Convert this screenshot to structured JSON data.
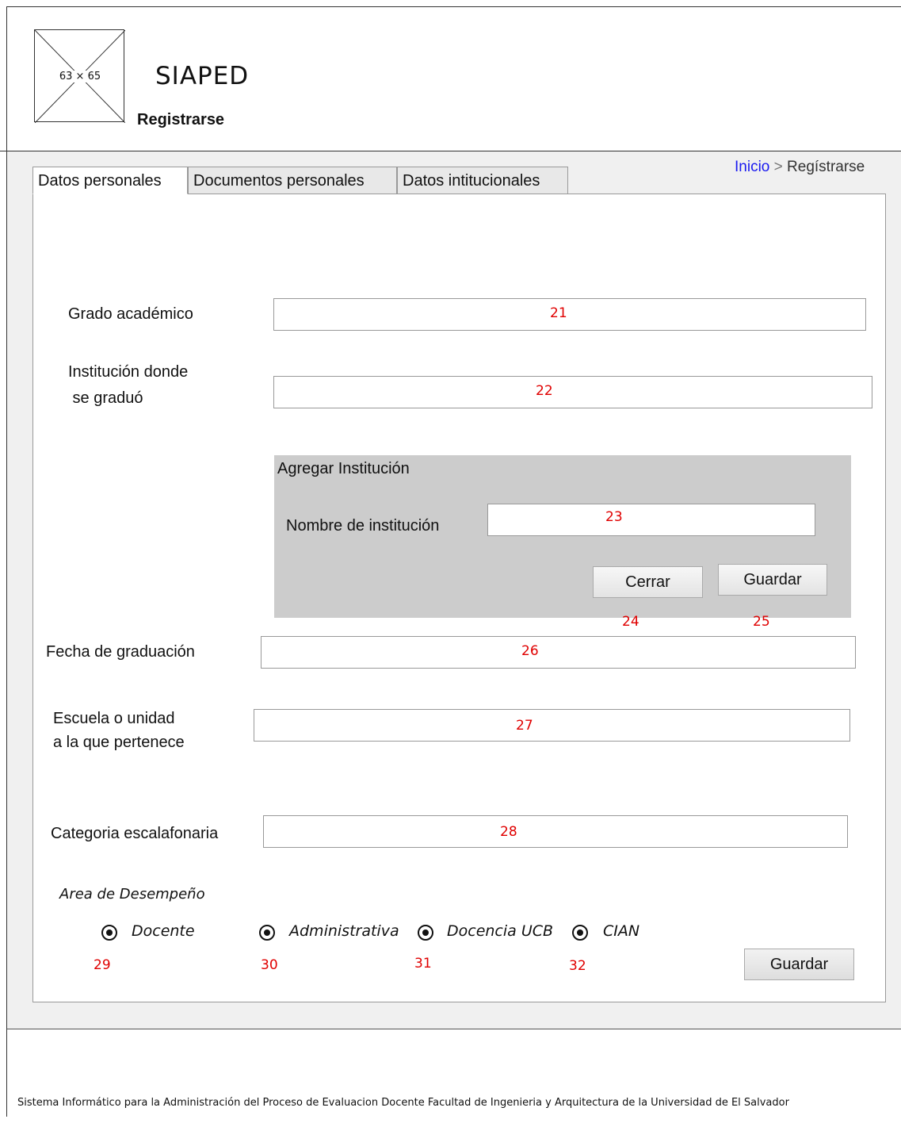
{
  "header": {
    "logo_placeholder": "63 × 65",
    "app_title": "SIAPED",
    "page_subtitle": "Registrarse"
  },
  "breadcrumb": {
    "home": "Inicio",
    "separator": ">",
    "current": "Regístrarse"
  },
  "tabs": [
    {
      "label": "Datos personales",
      "active": true
    },
    {
      "label": "Documentos personales",
      "active": false
    },
    {
      "label": "Datos intitucionales",
      "active": false
    }
  ],
  "form": {
    "grado_label": "Grado académico",
    "grado_num": "21",
    "institucion_label_1": "Institución donde",
    "institucion_label_2": " se graduó",
    "institucion_num": "22",
    "dialog": {
      "title": "Agregar Institución",
      "nombre_label": "Nombre de institución",
      "nombre_num": "23",
      "close_label": "Cerrar",
      "close_num": "24",
      "save_label": "Guardar",
      "save_num": "25"
    },
    "fecha_label": "Fecha de graduación",
    "fecha_num": "26",
    "escuela_label_1": "Escuela o unidad",
    "escuela_label_2": "a la que pertenece",
    "escuela_num": "27",
    "categoria_label": "Categoria escalafonaria",
    "categoria_num": "28",
    "area_label": "Area de Desempeño",
    "radios": [
      {
        "label": "Docente",
        "num": "29"
      },
      {
        "label": "Administrativa",
        "num": "30"
      },
      {
        "label": "Docencia UCB",
        "num": "31"
      },
      {
        "label": "CIAN",
        "num": "32"
      }
    ],
    "submit_label": "Guardar"
  },
  "footer": {
    "text": "Sistema Informático para la Administración del Proceso de Evaluacion Docente  Facultad de Ingenieria y Arquitectura de la Universidad de El Salvador"
  }
}
